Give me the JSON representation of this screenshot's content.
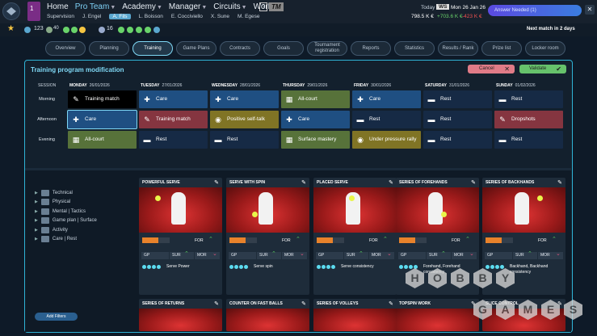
{
  "nav": {
    "items": [
      {
        "label": "Home",
        "active": false
      },
      {
        "label": "Pro Team",
        "active": true
      },
      {
        "label": "Academy",
        "active": false
      },
      {
        "label": "Manager",
        "active": false
      },
      {
        "label": "Circuits",
        "active": false
      },
      {
        "label": "World",
        "active": false
      }
    ],
    "help": "?",
    "tm": "TM",
    "mail_count": "1"
  },
  "subnav": {
    "items": [
      {
        "label": "Supervision",
        "active": false
      },
      {
        "label": "J. Engel",
        "active": false
      },
      {
        "label": "A. Fils",
        "active": true
      },
      {
        "label": "L. Boisson",
        "active": false
      },
      {
        "label": "E. Cocciviello",
        "active": false
      },
      {
        "label": "X. Sune",
        "active": false
      },
      {
        "label": "M. Egese",
        "active": false
      }
    ]
  },
  "status": {
    "today_label": "Today",
    "ws_badge": "WS",
    "date": "Mon 26 Jan 26",
    "balance": "798.5 K €",
    "income": "+703.6 K €",
    "expense": "-423 K €",
    "answer_label": "Answer Needed (1)"
  },
  "bar2": {
    "stat1": "123",
    "stat2": "40",
    "stat3": "16",
    "next_match": "Next match in 2 days"
  },
  "tabs": [
    {
      "label": "Overview",
      "active": false
    },
    {
      "label": "Planning",
      "active": false
    },
    {
      "label": "Training",
      "active": true
    },
    {
      "label": "Game Plans",
      "active": false
    },
    {
      "label": "Contracts",
      "active": false
    },
    {
      "label": "Goals",
      "active": false
    },
    {
      "label": "Tournament registration",
      "active": false
    },
    {
      "label": "Reports",
      "active": false
    },
    {
      "label": "Statistics",
      "active": false
    },
    {
      "label": "Results / Rank",
      "active": false
    },
    {
      "label": "Prize list",
      "active": false
    },
    {
      "label": "Locker room",
      "active": false
    }
  ],
  "panel": {
    "title": "Training program modification",
    "cancel": "Cancel",
    "validate": "Validate"
  },
  "schedule": {
    "session_label": "SESSION",
    "days": [
      {
        "name": "MONDAY",
        "date": "26/01/2026"
      },
      {
        "name": "TUESDAY",
        "date": "27/01/2026"
      },
      {
        "name": "WEDNESDAY",
        "date": "28/01/2026"
      },
      {
        "name": "THURSDAY",
        "date": "29/01/2026"
      },
      {
        "name": "FRIDAY",
        "date": "30/01/2026"
      },
      {
        "name": "SATURDAY",
        "date": "31/01/2026"
      },
      {
        "name": "SUNDAY",
        "date": "01/02/2026"
      }
    ],
    "rows": [
      {
        "label": "Morning",
        "cells": [
          {
            "text": "Training match",
            "kind": "match",
            "icon": "racket-icon"
          },
          {
            "text": "Care",
            "kind": "care",
            "icon": "medkit-icon"
          },
          {
            "text": "Care",
            "kind": "care",
            "icon": "medkit-icon"
          },
          {
            "text": "All-court",
            "kind": "court",
            "icon": "court-icon"
          },
          {
            "text": "Care",
            "kind": "care",
            "icon": "medkit-icon"
          },
          {
            "text": "Rest",
            "kind": "rest",
            "icon": "bed-icon"
          },
          {
            "text": "Rest",
            "kind": "rest",
            "icon": "bed-icon"
          }
        ]
      },
      {
        "label": "Afternoon",
        "cells": [
          {
            "text": "Care",
            "kind": "care",
            "icon": "medkit-icon",
            "selected": true
          },
          {
            "text": "Training match",
            "kind": "red",
            "icon": "racket-icon"
          },
          {
            "text": "Positive self-talk",
            "kind": "talk",
            "icon": "brain-icon"
          },
          {
            "text": "Care",
            "kind": "care",
            "icon": "medkit-icon"
          },
          {
            "text": "Rest",
            "kind": "rest",
            "icon": "bed-icon"
          },
          {
            "text": "Rest",
            "kind": "rest",
            "icon": "bed-icon"
          },
          {
            "text": "Dropshots",
            "kind": "red",
            "icon": "racket-icon"
          }
        ]
      },
      {
        "label": "Evening",
        "cells": [
          {
            "text": "All-court",
            "kind": "court",
            "icon": "court-icon"
          },
          {
            "text": "Rest",
            "kind": "rest",
            "icon": "bed-icon"
          },
          {
            "text": "Rest",
            "kind": "rest",
            "icon": "bed-icon"
          },
          {
            "text": "Surface mastery",
            "kind": "court",
            "icon": "court-icon"
          },
          {
            "text": "Under pressure rally",
            "kind": "talk",
            "icon": "brain-icon"
          },
          {
            "text": "Rest",
            "kind": "rest",
            "icon": "bed-icon"
          },
          {
            "text": "Rest",
            "kind": "rest",
            "icon": "bed-icon"
          }
        ]
      }
    ]
  },
  "filters": {
    "items": [
      "Technical",
      "Physical",
      "Mental | Tactics",
      "Game plan | Surface",
      "Activity",
      "Care | Rest"
    ],
    "add_label": "Add Filters"
  },
  "cards": [
    {
      "title": "POWERFUL SERVE",
      "for": "FOR",
      "gp": "GP",
      "sur": "SUR",
      "mor": "MOR",
      "dots": 4,
      "skill": "Serve Power",
      "progress": 0.6
    },
    {
      "title": "SERVE WITH SPIN",
      "for": "FOR",
      "gp": "GP",
      "sur": "SUR",
      "mor": "MOR",
      "dots": 4,
      "skill": "Serve spin",
      "progress": 0.6
    },
    {
      "title": "PLACED SERVE",
      "for": "FOR",
      "gp": "GP",
      "sur": "SUR",
      "mor": "MOR",
      "dots": 4,
      "skill": "Serve consistency",
      "progress": 0.6
    },
    {
      "title": "SERIES OF FOREHANDS",
      "for": "FOR",
      "gp": "GP",
      "sur": "SUR",
      "mor": "MOR",
      "dots": 4,
      "skill": "Forehand, Forehand consistency",
      "progress": 0.6
    },
    {
      "title": "SERIES OF BACKHANDS",
      "for": "FOR",
      "gp": "GP",
      "sur": "SUR",
      "mor": "MOR",
      "dots": 4,
      "skill": "Backhand, Backhand consistency",
      "progress": 0.6
    }
  ],
  "cards_row2": [
    {
      "title": "SERIES OF RETURNS"
    },
    {
      "title": "COUNTER ON FAST BALLS"
    },
    {
      "title": "SERIES OF VOLLEYS"
    },
    {
      "title": "TOPSPIN WORK"
    },
    {
      "title": "SLICE CONTROL"
    }
  ],
  "watermark": {
    "line1": "HOBBY",
    "line2": "GAMES"
  },
  "colors": {
    "accent": "#2fb3d6",
    "care": "#1f4f82",
    "rest": "#162a45",
    "court": "#57723a",
    "talk": "#807425",
    "red": "#853540"
  }
}
